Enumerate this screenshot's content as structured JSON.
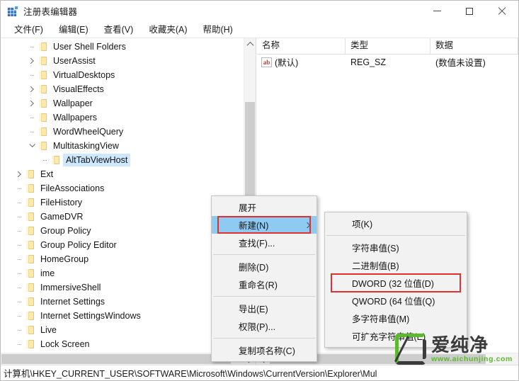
{
  "window": {
    "title": "注册表编辑器",
    "icon": "registry-editor-icon",
    "controls": {
      "minimize": "最小化",
      "maximize": "最大化",
      "close": "关闭"
    }
  },
  "menubar": {
    "items": [
      {
        "label": "文件(F)"
      },
      {
        "label": "编辑(E)"
      },
      {
        "label": "查看(V)"
      },
      {
        "label": "收藏夹(A)"
      },
      {
        "label": "帮助(H)"
      }
    ]
  },
  "tree": {
    "items": [
      {
        "label": "User Shell Folders",
        "indent": 2,
        "expander": "none",
        "selected": false
      },
      {
        "label": "UserAssist",
        "indent": 2,
        "expander": "collapsed",
        "selected": false
      },
      {
        "label": "VirtualDesktops",
        "indent": 2,
        "expander": "none",
        "selected": false
      },
      {
        "label": "VisualEffects",
        "indent": 2,
        "expander": "collapsed",
        "selected": false
      },
      {
        "label": "Wallpaper",
        "indent": 2,
        "expander": "collapsed",
        "selected": false
      },
      {
        "label": "Wallpapers",
        "indent": 2,
        "expander": "none",
        "selected": false
      },
      {
        "label": "WordWheelQuery",
        "indent": 2,
        "expander": "none",
        "selected": false
      },
      {
        "label": "MultitaskingView",
        "indent": 2,
        "expander": "expanded",
        "selected": false
      },
      {
        "label": "AltTabViewHost",
        "indent": 3,
        "expander": "none",
        "selected": true
      },
      {
        "label": "Ext",
        "indent": 1,
        "expander": "collapsed",
        "selected": false
      },
      {
        "label": "FileAssociations",
        "indent": 1,
        "expander": "none",
        "selected": false
      },
      {
        "label": "FileHistory",
        "indent": 1,
        "expander": "none",
        "selected": false
      },
      {
        "label": "GameDVR",
        "indent": 1,
        "expander": "none",
        "selected": false
      },
      {
        "label": "Group Policy",
        "indent": 1,
        "expander": "none",
        "selected": false
      },
      {
        "label": "Group Policy Editor",
        "indent": 1,
        "expander": "none",
        "selected": false
      },
      {
        "label": "HomeGroup",
        "indent": 1,
        "expander": "none",
        "selected": false
      },
      {
        "label": "ime",
        "indent": 1,
        "expander": "none",
        "selected": false
      },
      {
        "label": "ImmersiveShell",
        "indent": 1,
        "expander": "none",
        "selected": false
      },
      {
        "label": "Internet Settings",
        "indent": 1,
        "expander": "none",
        "selected": false
      },
      {
        "label": "Internet SettingsWindows",
        "indent": 1,
        "expander": "none",
        "selected": false
      },
      {
        "label": "Live",
        "indent": 1,
        "expander": "none",
        "selected": false
      },
      {
        "label": "Lock Screen",
        "indent": 1,
        "expander": "none",
        "selected": false
      }
    ]
  },
  "list": {
    "columns": [
      {
        "label": "名称"
      },
      {
        "label": "类型"
      },
      {
        "label": "数据"
      }
    ],
    "rows": [
      {
        "name": "(默认)",
        "type": "REG_SZ",
        "data": "(数值未设置)",
        "icon": "string-value-icon"
      }
    ]
  },
  "context_menu": {
    "items": [
      {
        "label": "展开",
        "active": false,
        "submenu": false,
        "separator_after": false
      },
      {
        "label": "新建(N)",
        "active": true,
        "submenu": true,
        "separator_after": false,
        "highlight_box": true
      },
      {
        "label": "查找(F)...",
        "active": false,
        "submenu": false,
        "separator_after": true
      },
      {
        "label": "删除(D)",
        "active": false,
        "submenu": false,
        "separator_after": false
      },
      {
        "label": "重命名(R)",
        "active": false,
        "submenu": false,
        "separator_after": true
      },
      {
        "label": "导出(E)",
        "active": false,
        "submenu": false,
        "separator_after": false
      },
      {
        "label": "权限(P)...",
        "active": false,
        "submenu": false,
        "separator_after": true
      },
      {
        "label": "复制项名称(C)",
        "active": false,
        "submenu": false,
        "separator_after": false
      }
    ]
  },
  "submenu": {
    "items": [
      {
        "label": "项(K)",
        "separator_after": true,
        "highlight_box": false
      },
      {
        "label": "字符串值(S)",
        "separator_after": false,
        "highlight_box": false
      },
      {
        "label": "二进制值(B)",
        "separator_after": false,
        "highlight_box": false
      },
      {
        "label": "DWORD (32 位值(D)",
        "separator_after": false,
        "highlight_box": true
      },
      {
        "label": "QWORD (64 位值(Q)",
        "separator_after": false,
        "highlight_box": false
      },
      {
        "label": "多字符串值(M)",
        "separator_after": false,
        "highlight_box": false
      },
      {
        "label": "可扩充字符串值(E)",
        "separator_after": false,
        "highlight_box": false
      }
    ]
  },
  "statusbar": {
    "path": "计算机\\HKEY_CURRENT_USER\\SOFTWARE\\Microsoft\\Windows\\CurrentVersion\\Explorer\\Mul"
  },
  "watermark": {
    "brand": "爱纯净",
    "url": "www.aichunjing.com",
    "color": "#5cb82e"
  },
  "colors": {
    "selection": "#cde8ff",
    "menu_highlight": "#8fcaf2",
    "red_box": "#e03030",
    "folder": "#fde9a9",
    "accent_green": "#5cb82e"
  }
}
